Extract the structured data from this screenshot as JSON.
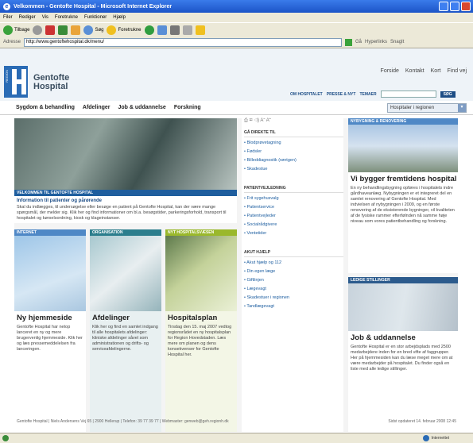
{
  "window": {
    "title": "Velkommen - Gentofte Hospital - Microsoft Internet Explorer"
  },
  "menubar": [
    "Filer",
    "Rediger",
    "Vis",
    "Foretrukne",
    "Funktioner",
    "Hjælp"
  ],
  "toolbar": {
    "back": "Tilbage",
    "search": "Søg",
    "favorites": "Foretrukne"
  },
  "addressbar": {
    "label": "Adresse",
    "url": "http://www.gentoftehospital.dk/menu/",
    "go": "Gå",
    "links": "Hyperlinks",
    "snagit": "SnagIt"
  },
  "header": {
    "logo_region": "REGION",
    "logo_text_1": "Gentofte",
    "logo_text_2": "Hospital",
    "toplinks": [
      "Forside",
      "Kontakt",
      "Kort",
      "Find vej"
    ],
    "midlinks": [
      "OM HOSPITALET",
      "PRESSE & NYT",
      "TEMAER"
    ],
    "search_button": "SØG"
  },
  "nav": {
    "items": [
      "Sygdom & behandling",
      "Afdelinger",
      "Job & uddannelse",
      "Forskning"
    ],
    "region_select": "Hospitaler i regionen"
  },
  "hero": {
    "caption": "VELKOMMEN TIL GENTOFTE HOSPITAL",
    "title": "Information til patienter og pårørende",
    "body": "Skal du indlægges, til undersøgelse eller besøge en patient på Gentofte Hospital, kan der være mange spørgsmål, der melder sig. Klik her og find informationer om bl.a. besøgstider, parkeringsforhold, transport til hospitalet og kørselsordning, kiosk og klageinstanser."
  },
  "quick": {
    "tools": "⎙ ✉ ◁) A⁻ A⁺",
    "sections": [
      {
        "title": "GÅ DIREKTE TIL",
        "links": [
          "Blodprøvetagning",
          "Fødsler",
          "Billeddiagnostik (røntgen)",
          "Skadestue"
        ]
      },
      {
        "title": "PATIENTVEJLEDNING",
        "links": [
          "Frit sygehusvalg",
          "Patientservice",
          "Patientvejleder",
          "Socialrådgivere",
          "Ventetider"
        ]
      },
      {
        "title": "AKUT HJÆLP",
        "links": [
          "Akut hjælp og 112",
          "Din egen læge",
          "Giftlinjen",
          "Lægevagt",
          "Skadestuer i regionen",
          "Tandlægevagt"
        ]
      }
    ]
  },
  "news": {
    "label": "NYBYGNING & RENOVERING",
    "title": "Vi bygger fremtidens hospital",
    "body": "En ny behandlingsbygning opføres i hospitalets indre gårdhaveanlæg. Nybygningen er et integreret del en samlet renovering af Gentofte Hospital. Med indvielsen af nybygningen i 2009, og en første renovering af de eksisterende bygninger, vil kvaliteten af de fysiske rammer efterfølnden nå samme høje niveau som vores patientbehandling og forskning."
  },
  "jobs": {
    "label": "LEDIGE STILLINGER",
    "title": "Job & uddannelse",
    "body": "Gentofte Hospital er en stor arbejdsplads med 2500 medarbejdere inden for en bred vifte af faggrupper. Her på hjemmesiden kan du læse meget mere om at være medarbejder på hospitalet. Du finder også en liste med alle ledige stillinger."
  },
  "boxes": [
    {
      "label": "INTERNET",
      "title": "Ny hjemmeside",
      "body": "Gentofte Hospital har netop lanceret en ny og mere brugervenlig hjemmeside. Klik her og læs pressemeddelelsen fra lanceringen."
    },
    {
      "label": "ORGANISATION",
      "title": "Afdelinger",
      "body": "Klik her og find en samlet indgang til alle hospitalets afdelinger: kliniske afdelinger såvel som administrationen og drifts- og serviceafdelingerne."
    },
    {
      "label": "NYT HOSPITALSVÆSEN",
      "title": "Hospitalsplan",
      "body": "Tirsdag den 15. maj 2007 vedtog regionsrådet en ny hospitalsplan for Region Hovedstaden. Læs mere om planen og dens konsekvenser for Gentofte Hospital her."
    }
  ],
  "footer": {
    "text": "Gentofte Hospital | Niels Andersens Vej 65 | 2900 Hellerup | Telefon: 39 77 39 77 | Webmaster: genweb@geh.regionh.dk",
    "updated": "Sidst opdateret 14. februar 2008 12:45"
  },
  "statusbar": {
    "zone": "Internettet"
  },
  "colors": {
    "titlebar": "#1b54c7",
    "link": "#1d5ea0",
    "internet_label": "#4f88c6",
    "organisation_label": "#2c7e8d",
    "hospitalsvaesen_label": "#9ab82c"
  }
}
